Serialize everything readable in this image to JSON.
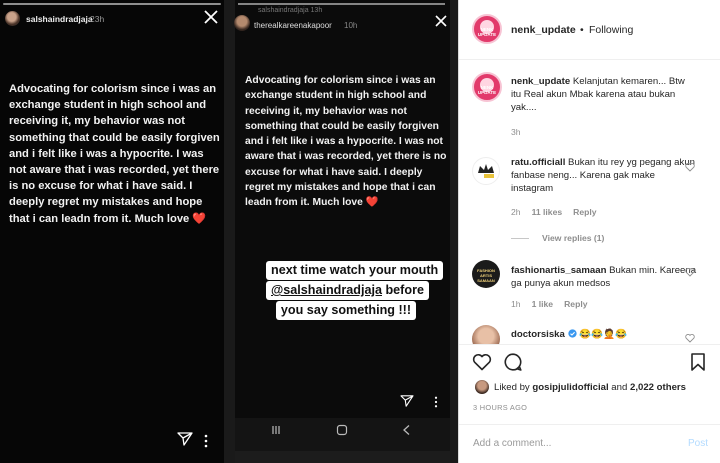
{
  "story1": {
    "username": "salshaindradjaja",
    "time": "23h",
    "message": "Advocating for colorism since i was an exchange student in high school and receiving it, my behavior was not something that could be easily forgiven and i felt like i was a hypocrite. I was not aware that i was recorded, yet there is no excuse for what i have said. I deeply regret my mistakes and hope that i can leadn from it. Much love",
    "heart": "❤️",
    "icons": [
      "close-icon",
      "send-icon",
      "more-icon"
    ]
  },
  "story2": {
    "ghost_header": "salshaindradjaja  13h",
    "username": "therealkareenakapoor",
    "time": "10h",
    "message": "Advocating for colorism since i was an exchange student in high school and receiving it, my behavior was not something that could be easily forgiven and i felt like i was a hypocrite. I was not aware that i was recorded, yet there is no excuse for what i have said. I deeply regret my mistakes and hope that i can leadn from it. Much love",
    "heart": "❤️",
    "sticker": {
      "line1": "next time watch your mouth",
      "line2": "@salshaindradjaja",
      "line2_rest": " before",
      "line3": "you say something !!!"
    }
  },
  "post": {
    "header": {
      "username": "nenk_update",
      "dot": "•",
      "follow_label": "Following",
      "avatar_text": "NENK UPDATE"
    },
    "caption": {
      "username": "nenk_update",
      "text": "Kelanjutan kemaren... Btw itu Real akun Mbak karena atau bukan yak....",
      "time": "3h"
    },
    "comments": [
      {
        "username": "ratu.officiall",
        "text": "Bukan itu rey yg pegang akun fanbase neng... Karena gak make instagram",
        "time": "2h",
        "likes": "11 likes",
        "reply": "Reply",
        "view_replies": "View replies (1)"
      },
      {
        "username": "fashionartis_samaan",
        "text": "Bukan min. Kareena ga punya akun medsos",
        "time": "1h",
        "likes": "1 like",
        "reply": "Reply",
        "avatar_text": "FASHION ARTIS SAMAAN"
      },
      {
        "username": "doctorsiska",
        "text": "😂😂🤦😂"
      }
    ],
    "likes": {
      "prefix": "Liked by",
      "user": "gosipjulidofficial",
      "and": "and",
      "count": "2,022 others"
    },
    "time_ago": "3 HOURS AGO",
    "add_comment_placeholder": "Add a comment...",
    "post_button": "Post"
  }
}
